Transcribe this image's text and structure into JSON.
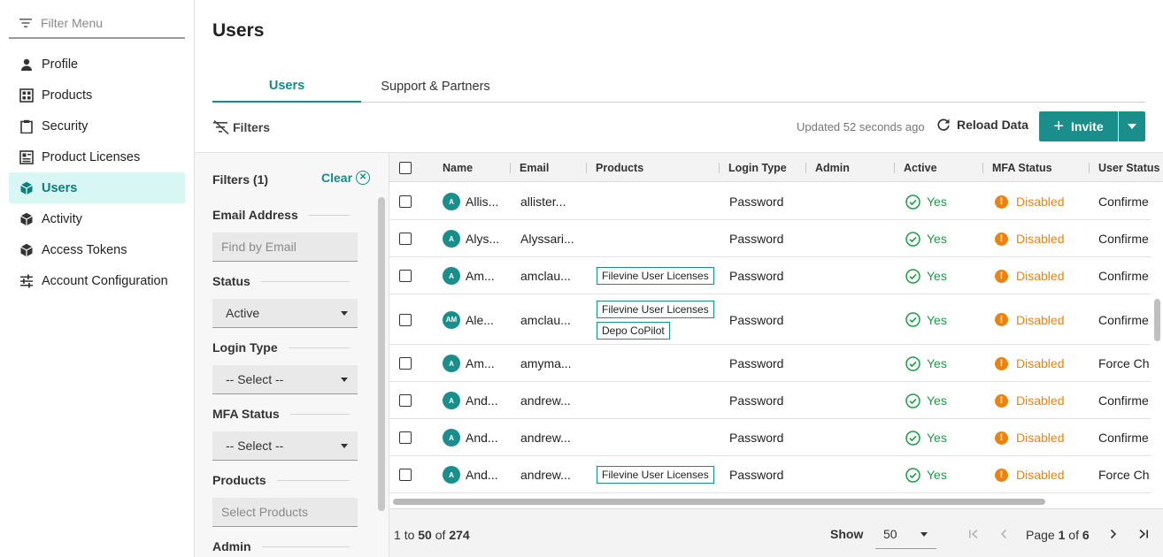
{
  "sidebar": {
    "filter_placeholder": "Filter Menu",
    "items": [
      {
        "label": "Profile",
        "icon": "person-icon"
      },
      {
        "label": "Products",
        "icon": "grid-icon"
      },
      {
        "label": "Security",
        "icon": "clipboard-icon"
      },
      {
        "label": "Product Licenses",
        "icon": "license-icon"
      },
      {
        "label": "Users",
        "icon": "cube-icon",
        "active": true
      },
      {
        "label": "Activity",
        "icon": "cube-icon"
      },
      {
        "label": "Access Tokens",
        "icon": "cube-icon"
      },
      {
        "label": "Account Configuration",
        "icon": "sliders-icon"
      }
    ]
  },
  "header": {
    "title": "Users",
    "tabs": [
      {
        "label": "Users",
        "active": true
      },
      {
        "label": "Support & Partners"
      }
    ]
  },
  "toolbar": {
    "filters_label": "Filters",
    "updated_text": "Updated 52 seconds ago",
    "reload_label": "Reload Data",
    "invite_label": "Invite"
  },
  "filters": {
    "title": "Filters (1)",
    "clear_label": "Clear",
    "email_label": "Email Address",
    "email_placeholder": "Find by Email",
    "status_label": "Status",
    "status_value": "Active",
    "login_type_label": "Login Type",
    "login_type_value": "-- Select --",
    "mfa_label": "MFA Status",
    "mfa_value": "-- Select --",
    "products_label": "Products",
    "products_placeholder": "Select Products",
    "admin_label": "Admin"
  },
  "grid": {
    "columns": [
      "Name",
      "Email",
      "Products",
      "Login Type",
      "Admin",
      "Active",
      "MFA Status",
      "User Status"
    ],
    "rows": [
      {
        "initials": "A",
        "name": "Allis...",
        "email": "allister...",
        "products": [],
        "login": "Password",
        "active": "Yes",
        "mfa": "Disabled",
        "status": "Confirme"
      },
      {
        "initials": "A",
        "name": "Alys...",
        "email": "Alyssari...",
        "products": [],
        "login": "Password",
        "active": "Yes",
        "mfa": "Disabled",
        "status": "Confirme"
      },
      {
        "initials": "A",
        "name": "Am...",
        "email": "amclau...",
        "products": [
          "Filevine User Licenses"
        ],
        "login": "Password",
        "active": "Yes",
        "mfa": "Disabled",
        "status": "Confirme"
      },
      {
        "initials": "AM",
        "name": "Ale...",
        "email": "amclau...",
        "products": [
          "Filevine User Licenses",
          "Depo CoPilot"
        ],
        "login": "Password",
        "active": "Yes",
        "mfa": "Disabled",
        "status": "Confirme"
      },
      {
        "initials": "A",
        "name": "Am...",
        "email": "amyma...",
        "products": [],
        "login": "Password",
        "active": "Yes",
        "mfa": "Disabled",
        "status": "Force Ch"
      },
      {
        "initials": "A",
        "name": "And...",
        "email": "andrew...",
        "products": [],
        "login": "Password",
        "active": "Yes",
        "mfa": "Disabled",
        "status": "Confirme"
      },
      {
        "initials": "A",
        "name": "And...",
        "email": "andrew...",
        "products": [],
        "login": "Password",
        "active": "Yes",
        "mfa": "Disabled",
        "status": "Confirme"
      },
      {
        "initials": "A",
        "name": "And...",
        "email": "andrew...",
        "products": [
          "Filevine User Licenses"
        ],
        "login": "Password",
        "active": "Yes",
        "mfa": "Disabled",
        "status": "Force Ch"
      }
    ]
  },
  "pagination": {
    "range_start": "1",
    "range_to": "to",
    "range_end": "50",
    "range_of": "of",
    "total": "274",
    "show_label": "Show",
    "page_size": "50",
    "page_label": "Page",
    "page_current": "1",
    "page_of": "of",
    "page_total": "6"
  },
  "colors": {
    "accent": "#1a8e8a",
    "active_nav_bg": "#d8f6f4",
    "yes": "#1f9a4a",
    "disabled": "#e98411"
  }
}
